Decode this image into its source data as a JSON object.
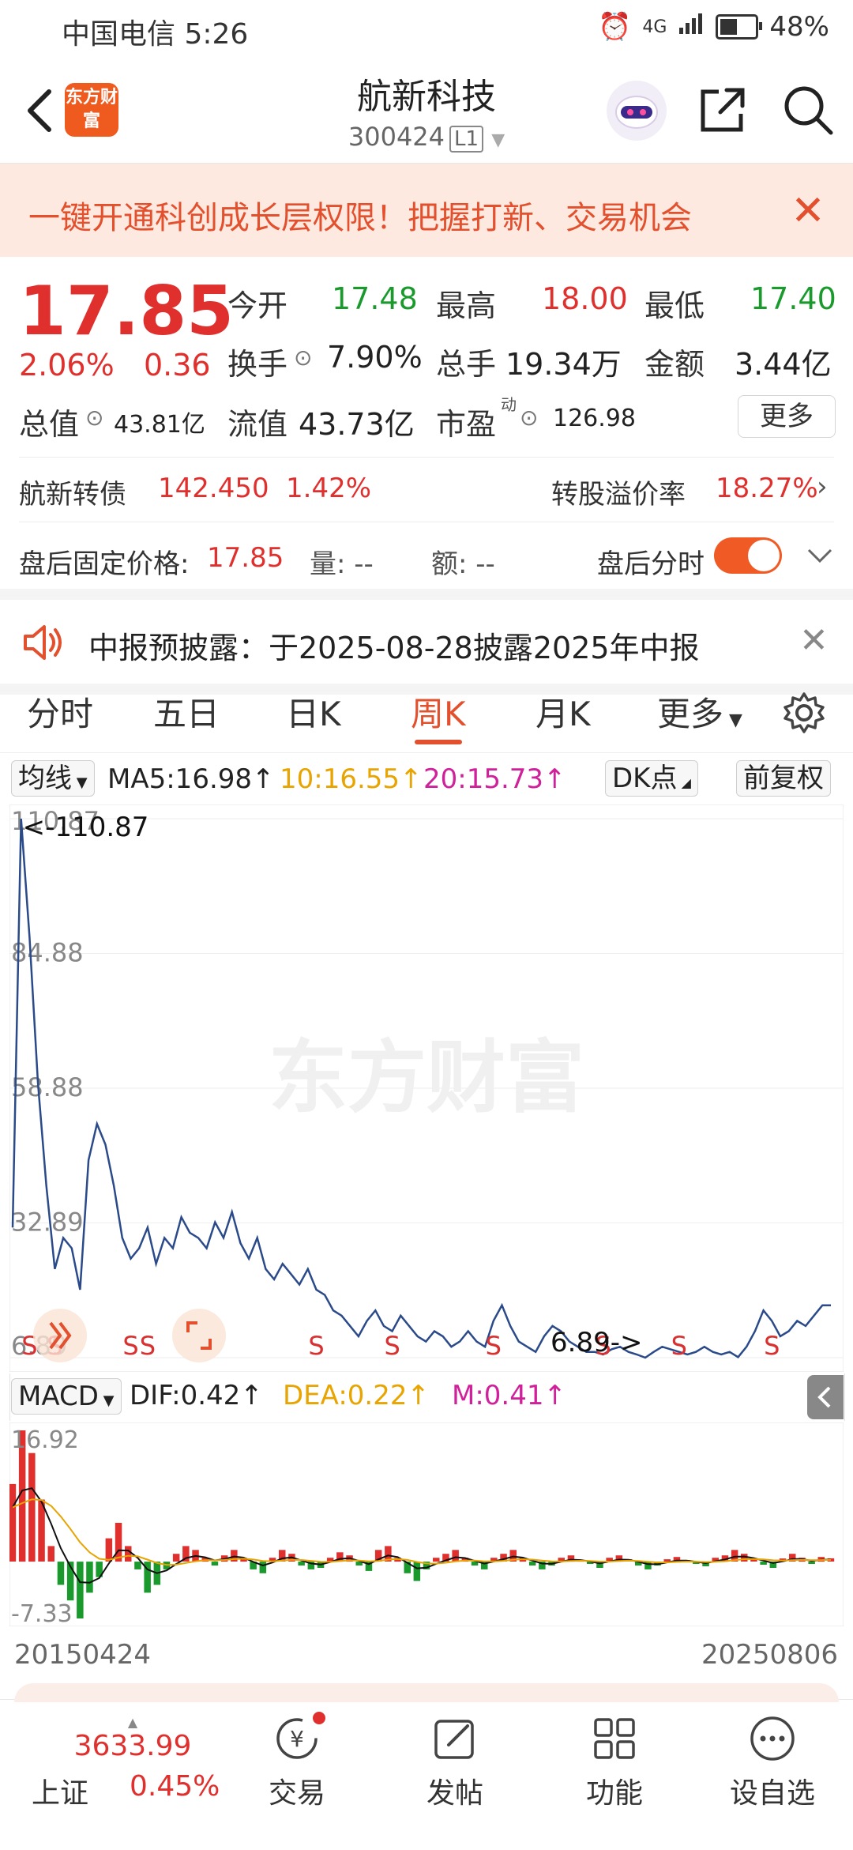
{
  "status_bar": {
    "carrier_time": "中国电信 5:26",
    "network": "4G",
    "battery": "48%",
    "battery_level": 0.48
  },
  "header": {
    "logo_text": "东方财富",
    "name": "航新科技",
    "code": "300424",
    "level_tag": "L1"
  },
  "banner": {
    "text": "一键开通科创成长层权限！把握打新、交易机会"
  },
  "quote": {
    "price": "17.85",
    "change_pct": "2.06%",
    "change_abs": "0.36",
    "open_label": "今开",
    "open_value": "17.48",
    "high_label": "最高",
    "high_value": "18.00",
    "low_label": "最低",
    "low_value": "17.40",
    "turnover_label": "换手",
    "turnover_value": "7.90%",
    "volume_label": "总手",
    "volume_value": "19.34万",
    "amount_label": "金额",
    "amount_value": "3.44亿",
    "mcap_label": "总值",
    "mcap_value": "43.81亿",
    "float_label": "流值",
    "float_value": "43.73亿",
    "pe_label": "市盈",
    "pe_sup": "动",
    "pe_value": "126.98",
    "more_button": "更多"
  },
  "bond": {
    "name": "航新转债",
    "price": "142.450",
    "pct": "1.42%",
    "premium_label": "转股溢价率",
    "premium_value": "18.27%"
  },
  "after_hours": {
    "price_label": "盘后固定价格:",
    "price_value": "17.85",
    "volume_label": "量: --",
    "amount_label": "额: --",
    "intraday_label": "盘后分时",
    "toggle_on": true
  },
  "notice": {
    "text": "中报预披露：于2025-08-28披露2025年中报"
  },
  "tabs": [
    "分时",
    "五日",
    "日K",
    "周K",
    "月K",
    "更多"
  ],
  "active_tab": "周K",
  "ma_bar": {
    "select_label": "均线",
    "ma5": "MA5:16.98",
    "ma10": "10:16.55",
    "ma20": "20:15.73",
    "dk_label": "DK点",
    "adjust_label": "前复权",
    "ma5_color": "#222222",
    "ma10_color": "#e8a400",
    "ma20_color": "#d0209a"
  },
  "macd_bar": {
    "select_label": "MACD",
    "dif": "DIF:0.42",
    "dea": "DEA:0.22",
    "m": "M:0.41",
    "dea_color": "#e8a400",
    "m_color": "#d0209a"
  },
  "chart_data": [
    {
      "type": "line",
      "series_color": "#2a4a8a",
      "y_ticks": [
        "110.87",
        "84.88",
        "58.88",
        "32.89",
        "6.89"
      ],
      "ylim": [
        6.89,
        110.87
      ],
      "max_label": "<-110.87",
      "min_label": "6.89->",
      "sell_marker": "S",
      "watermark": "东方财富",
      "values": [
        32.0,
        110.87,
        88.0,
        60.0,
        40.0,
        24.0,
        30.0,
        28.0,
        20.0,
        45.0,
        52.0,
        48.0,
        40.0,
        30.0,
        26.0,
        28.0,
        32.0,
        25.0,
        30.0,
        28.0,
        34.0,
        31.0,
        30.0,
        28.0,
        33.0,
        30.0,
        35.0,
        29.0,
        26.0,
        30.0,
        24.0,
        22.0,
        25.0,
        23.0,
        21.0,
        24.0,
        20.0,
        19.0,
        16.0,
        15.0,
        13.0,
        11.0,
        14.0,
        16.0,
        13.0,
        12.0,
        15.0,
        13.0,
        11.0,
        10.0,
        12.0,
        11.0,
        9.0,
        10.0,
        12.0,
        10.0,
        9.0,
        14.0,
        17.0,
        13.0,
        10.0,
        9.0,
        8.0,
        11.0,
        13.0,
        12.0,
        10.0,
        9.0,
        8.0,
        8.0,
        7.5,
        8.5,
        9.0,
        8.0,
        7.5,
        6.89,
        8.0,
        9.0,
        8.5,
        8.0,
        7.5,
        8.0,
        9.0,
        8.0,
        7.5,
        8.0,
        7.0,
        9.0,
        12.0,
        16.0,
        14.0,
        11.0,
        12.0,
        14.0,
        13.0,
        15.0,
        17.0,
        16.98
      ]
    },
    {
      "type": "bar",
      "y_ticks": [
        "16.92",
        "-7.33"
      ],
      "ylim": [
        -7.33,
        16.92
      ],
      "x_start": "20150424",
      "x_end": "20250806",
      "values": [
        10.0,
        16.92,
        14.0,
        8.0,
        2.0,
        -3.0,
        -5.0,
        -7.33,
        -4.0,
        -2.0,
        3.0,
        5.0,
        2.0,
        -1.0,
        -4.0,
        -3.0,
        -1.0,
        1.0,
        2.0,
        1.5,
        0.5,
        -0.5,
        0.8,
        1.5,
        0.5,
        -1.0,
        -1.5,
        0.5,
        1.5,
        1.0,
        -0.5,
        -1.0,
        -0.8,
        0.5,
        1.2,
        0.8,
        -0.5,
        -1.2,
        1.5,
        2.0,
        0.5,
        -1.5,
        -2.5,
        -1.0,
        0.5,
        1.0,
        1.5,
        0.5,
        -0.5,
        -1.0,
        0.5,
        1.0,
        1.5,
        0.5,
        -0.5,
        -1.0,
        -0.5,
        0.5,
        0.8,
        0.2,
        -0.3,
        -0.8,
        0.5,
        0.8,
        0.3,
        -0.5,
        -1.0,
        -0.5,
        0.3,
        0.6,
        0.2,
        -0.3,
        -0.6,
        0.5,
        0.8,
        1.5,
        1.0,
        0.3,
        -0.4,
        -0.8,
        0.4,
        1.0,
        0.5,
        -0.3,
        0.6,
        0.42
      ]
    }
  ],
  "bottom_nav": {
    "index_value": "3633.99",
    "index_name": "上证",
    "index_pct": "0.45%",
    "items": [
      "交易",
      "发帖",
      "功能",
      "设自选"
    ]
  }
}
